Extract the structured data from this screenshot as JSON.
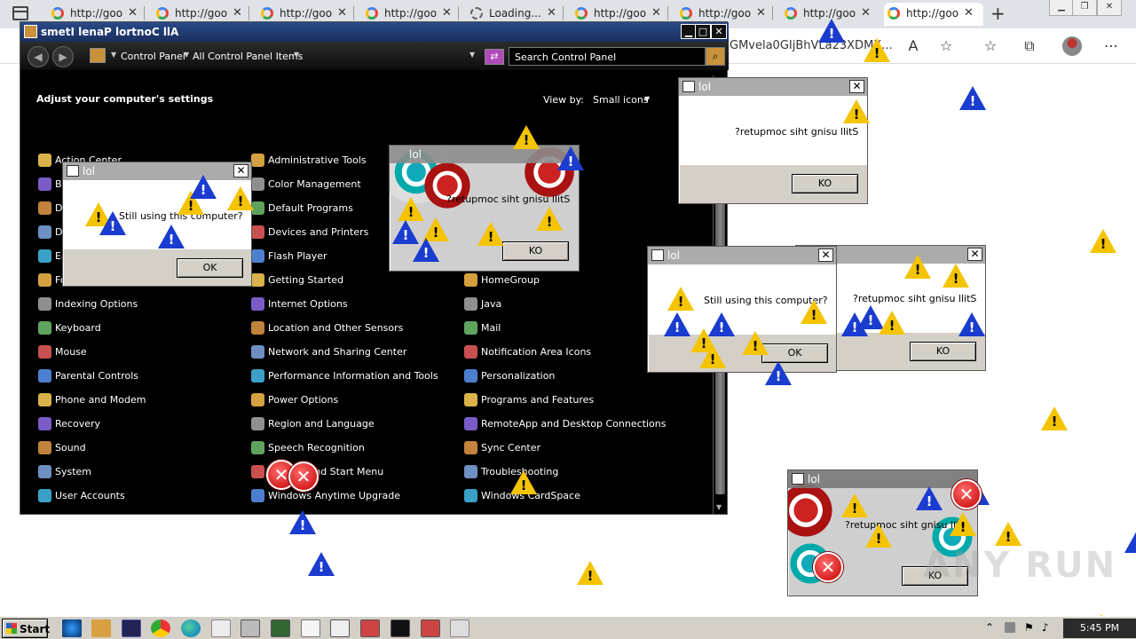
{
  "browser": {
    "tabs": [
      {
        "label": "http://goo",
        "loading": false
      },
      {
        "label": "http://goo",
        "loading": false
      },
      {
        "label": "http://goo",
        "loading": false
      },
      {
        "label": "http://goo",
        "loading": false
      },
      {
        "label": "Loading...",
        "loading": true
      },
      {
        "label": "http://goo",
        "loading": false
      },
      {
        "label": "http://goo",
        "loading": false
      },
      {
        "label": "http://goo",
        "loading": false
      },
      {
        "label": "http://goo",
        "loading": true
      }
    ],
    "url_fragment": "GMvela0GIjBhVLa23XDMX..."
  },
  "control_panel": {
    "title": "smetI lenaP lortnoC llA",
    "breadcrumb": [
      "Control Panel",
      "All Control Panel Items"
    ],
    "search_placeholder": "Search Control Panel",
    "heading": "Adjust your computer's settings",
    "view_by_label": "View by:",
    "view_by_value": "Small icons",
    "columns": [
      [
        "Action Center",
        "Backup and Restore",
        "Date and Time",
        "Device Manager",
        "Ease of Access Center",
        "Folder Options",
        "Indexing Options",
        "Keyboard",
        "Mouse",
        "Parental Controls",
        "Phone and Modem",
        "Recovery",
        "Sound",
        "System",
        "User Accounts"
      ],
      [
        "Administrative Tools",
        "Color Management",
        "Default Programs",
        "Devices and Printers",
        "Flash Player",
        "Getting Started",
        "Internet Options",
        "Location and Other Sensors",
        "Network and Sharing Center",
        "Performance Information and Tools",
        "Power Options",
        "Region and Language",
        "Speech Recognition",
        "Taskbar and Start Menu",
        "Windows Anytime Upgrade"
      ],
      [
        "",
        "",
        "",
        "",
        "",
        "HomeGroup",
        "Java",
        "Mail",
        "Notification Area Icons",
        "Personalization",
        "Programs and Features",
        "RemoteApp and Desktop Connections",
        "Sync Center",
        "Troubleshooting",
        "Windows CardSpace"
      ]
    ]
  },
  "dialogs": [
    {
      "title": "lol",
      "message": "Still using this computer?",
      "button": "OK"
    },
    {
      "title": "lol",
      "message": "?retupmoc siht gnisu llitS",
      "button": "KO"
    },
    {
      "title": "lol",
      "message": "?retupmoc siht gnisu llitS",
      "button": "KO"
    },
    {
      "title": "lol",
      "message": "Still using this computer?",
      "button": "OK"
    },
    {
      "title": "",
      "message": "?retupmoc siht gnisu llitS",
      "button": "KO"
    },
    {
      "title": "lol",
      "message": "?retupmoc siht gnisu llitS",
      "button": "KO"
    }
  ],
  "taskbar": {
    "start_label": "Start",
    "clock": "5:45 PM"
  },
  "watermark": "ANY RUN",
  "colors": {
    "warning_yellow": "#f5c400",
    "warning_blue": "#1a3ccf",
    "error_red": "#c40000",
    "cp_background": "#000000"
  }
}
